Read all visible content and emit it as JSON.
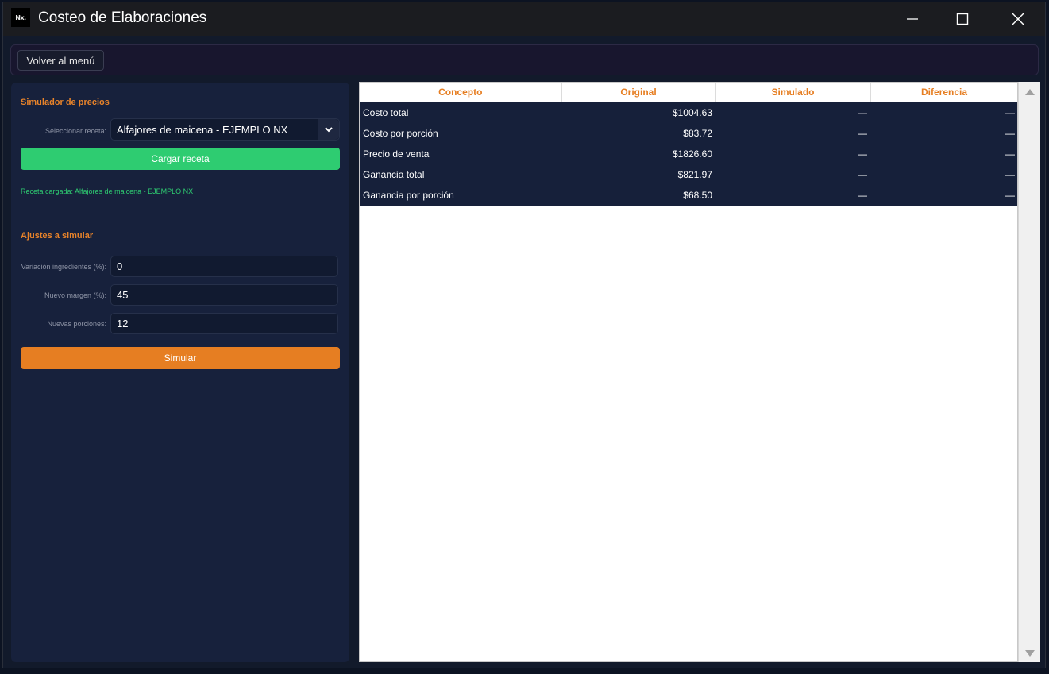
{
  "window": {
    "title": "Costeo de Elaboraciones",
    "logo_text": "Nx."
  },
  "toolbar": {
    "back_label": "Volver al menú"
  },
  "simulator": {
    "section_title": "Simulador de precios",
    "select_label": "Seleccionar receta:",
    "select_value": "Alfajores de maicena - EJEMPLO NX",
    "load_button": "Cargar receta",
    "status": "Receta cargada: Alfajores de maicena - EJEMPLO NX"
  },
  "adjustments": {
    "section_title": "Ajustes a simular",
    "fields": [
      {
        "label": "Variación ingredientes (%):",
        "value": "0"
      },
      {
        "label": "Nuevo margen (%):",
        "value": "45"
      },
      {
        "label": "Nuevas porciones:",
        "value": "12"
      }
    ],
    "simulate_button": "Simular"
  },
  "table": {
    "headers": [
      "Concepto",
      "Original",
      "Simulado",
      "Diferencia"
    ],
    "rows": [
      [
        "Costo total",
        "$1004.63",
        "—",
        "—"
      ],
      [
        "Costo por porción",
        "$83.72",
        "—",
        "—"
      ],
      [
        "Precio de venta",
        "$1826.60",
        "—",
        "—"
      ],
      [
        "Ganancia total",
        "$821.97",
        "—",
        "—"
      ],
      [
        "Ganancia por porción",
        "$68.50",
        "—",
        "—"
      ]
    ]
  },
  "colors": {
    "accent_orange": "#e67e22",
    "accent_green": "#2ecc71",
    "panel_bg": "#17213c",
    "table_row_bg": "#16203a"
  }
}
